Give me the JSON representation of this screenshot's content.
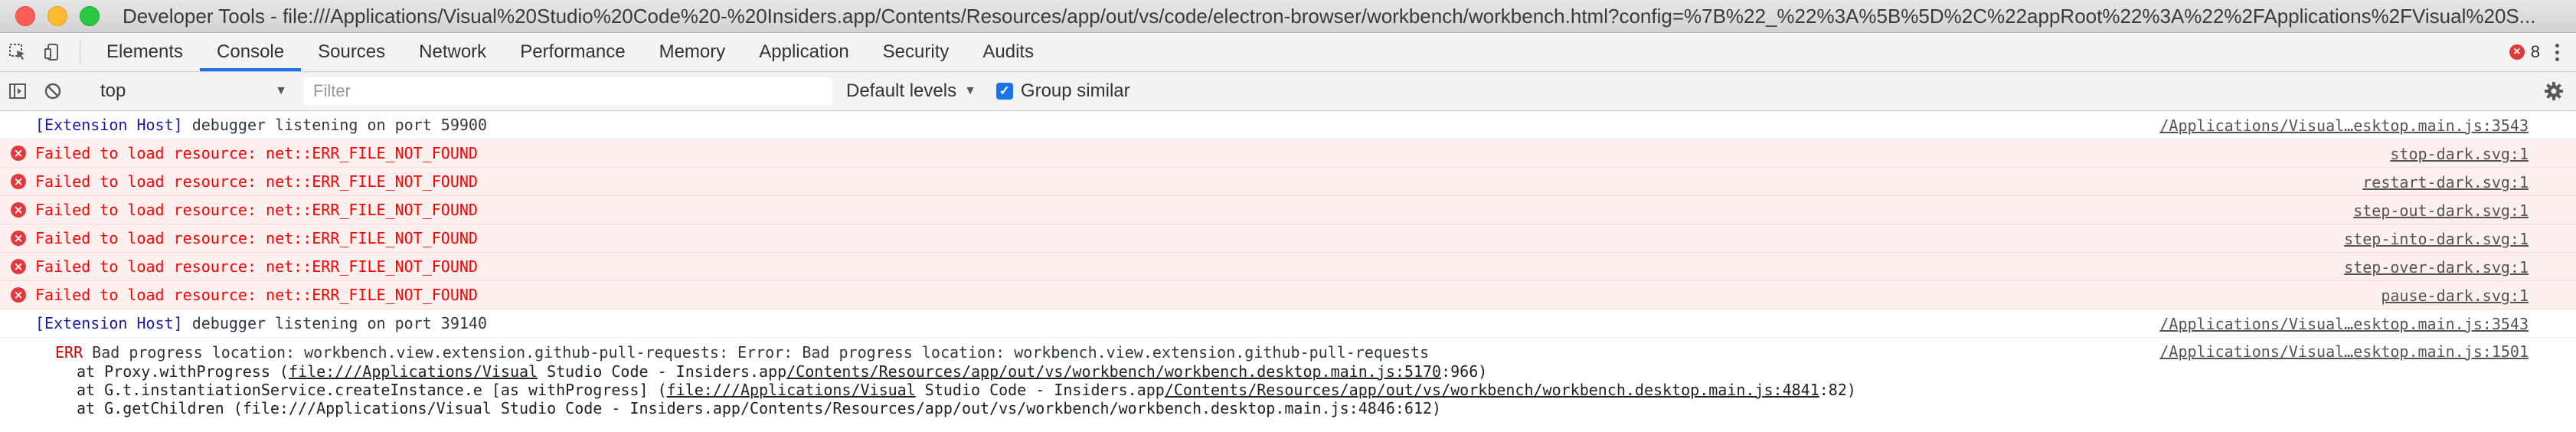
{
  "window": {
    "title": "Developer Tools - file:///Applications/Visual%20Studio%20Code%20-%20Insiders.app/Contents/Resources/app/out/vs/code/electron-browser/workbench/workbench.html?config=%7B%22_%22%3A%5B%5D%2C%22appRoot%22%3A%22%2FApplications%2FVisual%20S..."
  },
  "tabs": [
    {
      "label": "Elements"
    },
    {
      "label": "Console"
    },
    {
      "label": "Sources"
    },
    {
      "label": "Network"
    },
    {
      "label": "Performance"
    },
    {
      "label": "Memory"
    },
    {
      "label": "Application"
    },
    {
      "label": "Security"
    },
    {
      "label": "Audits"
    }
  ],
  "active_tab": "Console",
  "error_count": "8",
  "toolbar": {
    "context": "top",
    "filter_placeholder": "Filter",
    "filter_value": "",
    "levels_label": "Default levels",
    "group_similar_label": "Group similar",
    "group_similar_checked": true
  },
  "messages": [
    {
      "type": "log",
      "tag": "[Extension Host]",
      "text": " debugger listening on port 59900",
      "source": "/Applications/Visual…esktop.main.js:3543"
    },
    {
      "type": "error",
      "text": "Failed to load resource: net::ERR_FILE_NOT_FOUND",
      "source": "stop-dark.svg:1"
    },
    {
      "type": "error",
      "text": "Failed to load resource: net::ERR_FILE_NOT_FOUND",
      "source": "restart-dark.svg:1"
    },
    {
      "type": "error",
      "text": "Failed to load resource: net::ERR_FILE_NOT_FOUND",
      "source": "step-out-dark.svg:1"
    },
    {
      "type": "error",
      "text": "Failed to load resource: net::ERR_FILE_NOT_FOUND",
      "source": "step-into-dark.svg:1"
    },
    {
      "type": "error",
      "text": "Failed to load resource: net::ERR_FILE_NOT_FOUND",
      "source": "step-over-dark.svg:1"
    },
    {
      "type": "error",
      "text": "Failed to load resource: net::ERR_FILE_NOT_FOUND",
      "source": "pause-dark.svg:1"
    },
    {
      "type": "log",
      "tag": "[Extension Host]",
      "text": " debugger listening on port 39140",
      "source": "/Applications/Visual…esktop.main.js:3543"
    }
  ],
  "stack_message": {
    "head_prefix": "ERR",
    "head_text": " Bad progress location: workbench.view.extension.github-pull-requests: Error: Bad progress location: workbench.view.extension.github-pull-requests",
    "source": "/Applications/Visual…esktop.main.js:1501",
    "lines": [
      {
        "pre": "at Proxy.withProgress (",
        "link1": "file:///Applications/Visual",
        "mid": " Studio Code - Insiders.app",
        "link2": "/Contents/Resources/app/out/vs/workbench/workbench.desktop.main.js:5170",
        "post": ":966)"
      },
      {
        "pre": "at G.t.instantiationService.createInstance.e [as withProgress] (",
        "link1": "file:///Applications/Visual",
        "mid": " Studio Code - Insiders.app",
        "link2": "/Contents/Resources/app/out/vs/workbench/workbench.desktop.main.js:4841",
        "post": ":82)"
      },
      {
        "pre": "at G.getChildren (file:///Applications/Visual Studio Code - Insiders.app/Contents/Resources/app/out/vs/workbench/workbench.desktop.main.js:4846:612)",
        "link1": "",
        "mid": "",
        "link2": "",
        "post": ""
      }
    ]
  },
  "colors": {
    "accent": "#1a73e8",
    "error_text": "#ff0000",
    "error_bg": "#fff0f0",
    "error_icon": "#e0393e",
    "tag": "#1a1aa6"
  }
}
